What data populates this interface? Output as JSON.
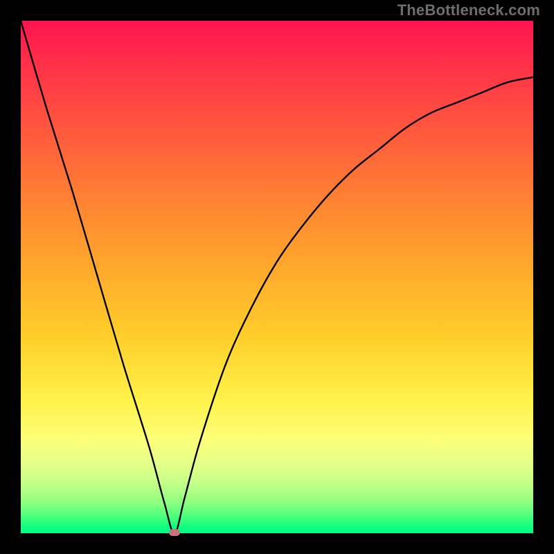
{
  "attribution": "TheBottleneck.com",
  "colors": {
    "page_bg": "#000000",
    "gradient_top": "#ff1450",
    "gradient_mid": "#ffdd33",
    "gradient_bottom": "#00ff88",
    "curve_stroke": "#000000",
    "marker_fill": "#c9747d",
    "attribution_text": "#6e6e6e"
  },
  "chart_data": {
    "type": "line",
    "title": "",
    "xlabel": "",
    "ylabel": "",
    "xlim": [
      0,
      1
    ],
    "ylim": [
      0,
      1
    ],
    "x_optimum": 0.3,
    "series": [
      {
        "name": "bottleneck-curve",
        "x": [
          0.0,
          0.05,
          0.1,
          0.15,
          0.2,
          0.25,
          0.28,
          0.3,
          0.32,
          0.35,
          0.4,
          0.45,
          0.5,
          0.55,
          0.6,
          0.65,
          0.7,
          0.75,
          0.8,
          0.85,
          0.9,
          0.95,
          1.0
        ],
        "y": [
          1.0,
          0.83,
          0.67,
          0.5,
          0.33,
          0.17,
          0.06,
          0.0,
          0.07,
          0.18,
          0.33,
          0.44,
          0.53,
          0.6,
          0.66,
          0.71,
          0.75,
          0.79,
          0.82,
          0.84,
          0.86,
          0.88,
          0.89
        ]
      }
    ],
    "annotations": [
      {
        "name": "min-marker",
        "x": 0.3,
        "y": 0.0
      }
    ]
  }
}
